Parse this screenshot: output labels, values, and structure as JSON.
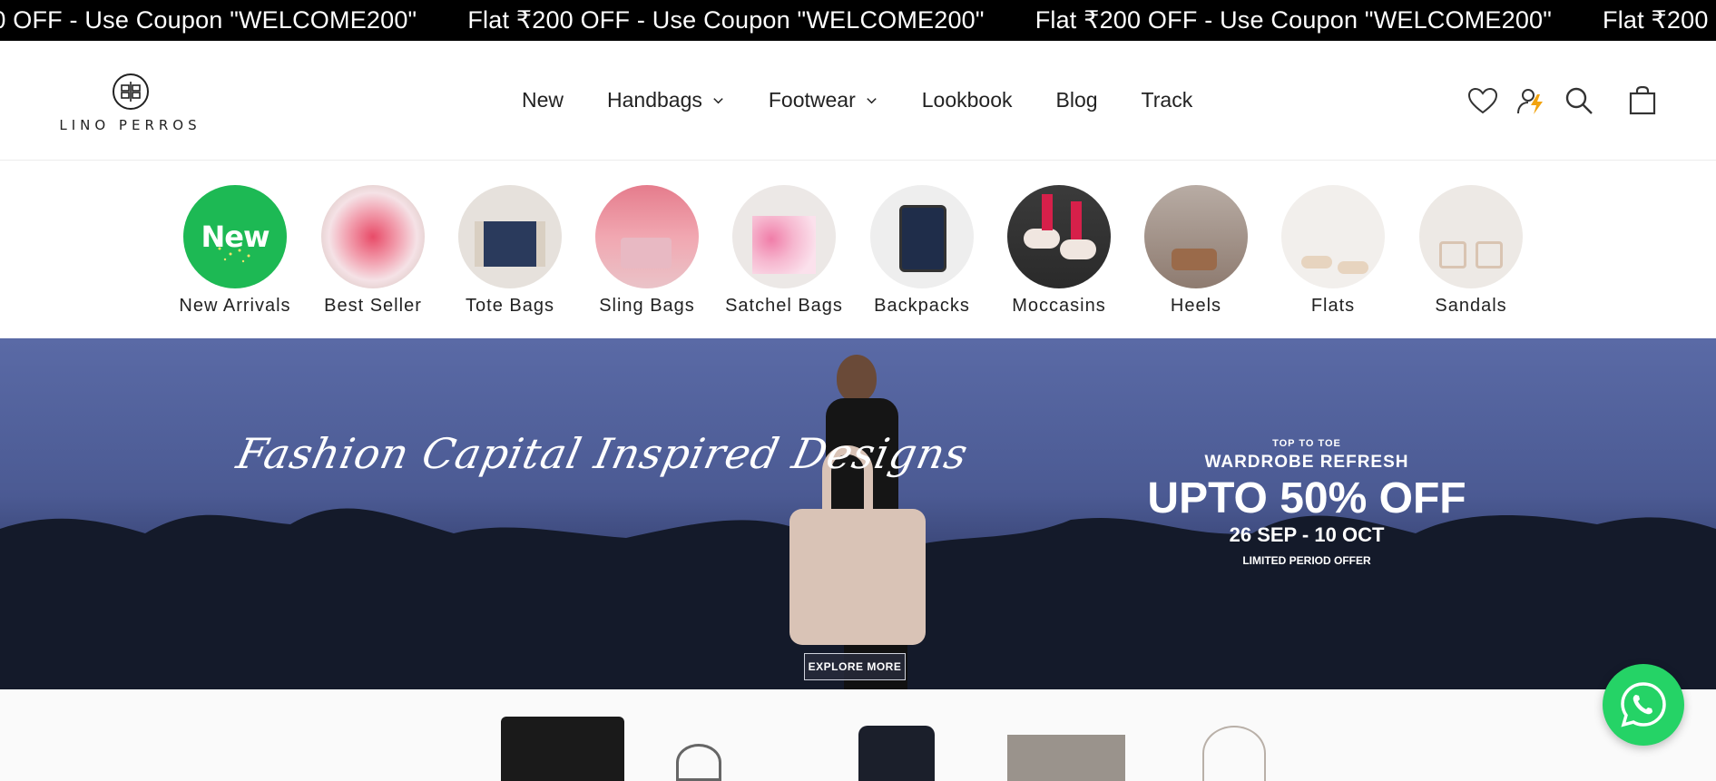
{
  "announcement": {
    "messages": [
      "Flat ₹200 OFF - Use Coupon \"WELCOME200\"",
      "Flat ₹200 OFF - Use Coupon \"WELCOME200\"",
      "Flat ₹200 OFF - Use Coupon \"WELCOME200\"",
      "Flat ₹200 OFF - Use Coupon \"WELCOME200\""
    ]
  },
  "header": {
    "logo_text": "LINO PERROS",
    "nav": [
      {
        "label": "New"
      },
      {
        "label": "Handbags"
      },
      {
        "label": "Footwear"
      },
      {
        "label": "Lookbook"
      },
      {
        "label": "Blog"
      },
      {
        "label": "Track"
      }
    ],
    "icons": [
      "heart-icon",
      "lightning-user-icon",
      "search-icon",
      "bag-icon"
    ]
  },
  "categories": [
    {
      "label": "New Arrivals",
      "badge": "New"
    },
    {
      "label": "Best Seller"
    },
    {
      "label": "Tote Bags"
    },
    {
      "label": "Sling Bags"
    },
    {
      "label": "Satchel Bags"
    },
    {
      "label": "Backpacks"
    },
    {
      "label": "Moccasins"
    },
    {
      "label": "Heels"
    },
    {
      "label": "Flats"
    },
    {
      "label": "Sandals"
    }
  ],
  "hero": {
    "script_text": "Fashion Capital Inspired Designs",
    "offer_small": "TOP TO TOE",
    "offer_title": "WARDROBE REFRESH",
    "offer_big": "UPTO 50% OFF",
    "offer_dates": "26 SEP - 10 OCT",
    "offer_note": "LIMITED PERIOD OFFER",
    "cta": "EXPLORE MORE"
  },
  "colors": {
    "accent_green": "#25d366",
    "new_badge_green": "#1db954",
    "announcement_bg": "#000000"
  }
}
